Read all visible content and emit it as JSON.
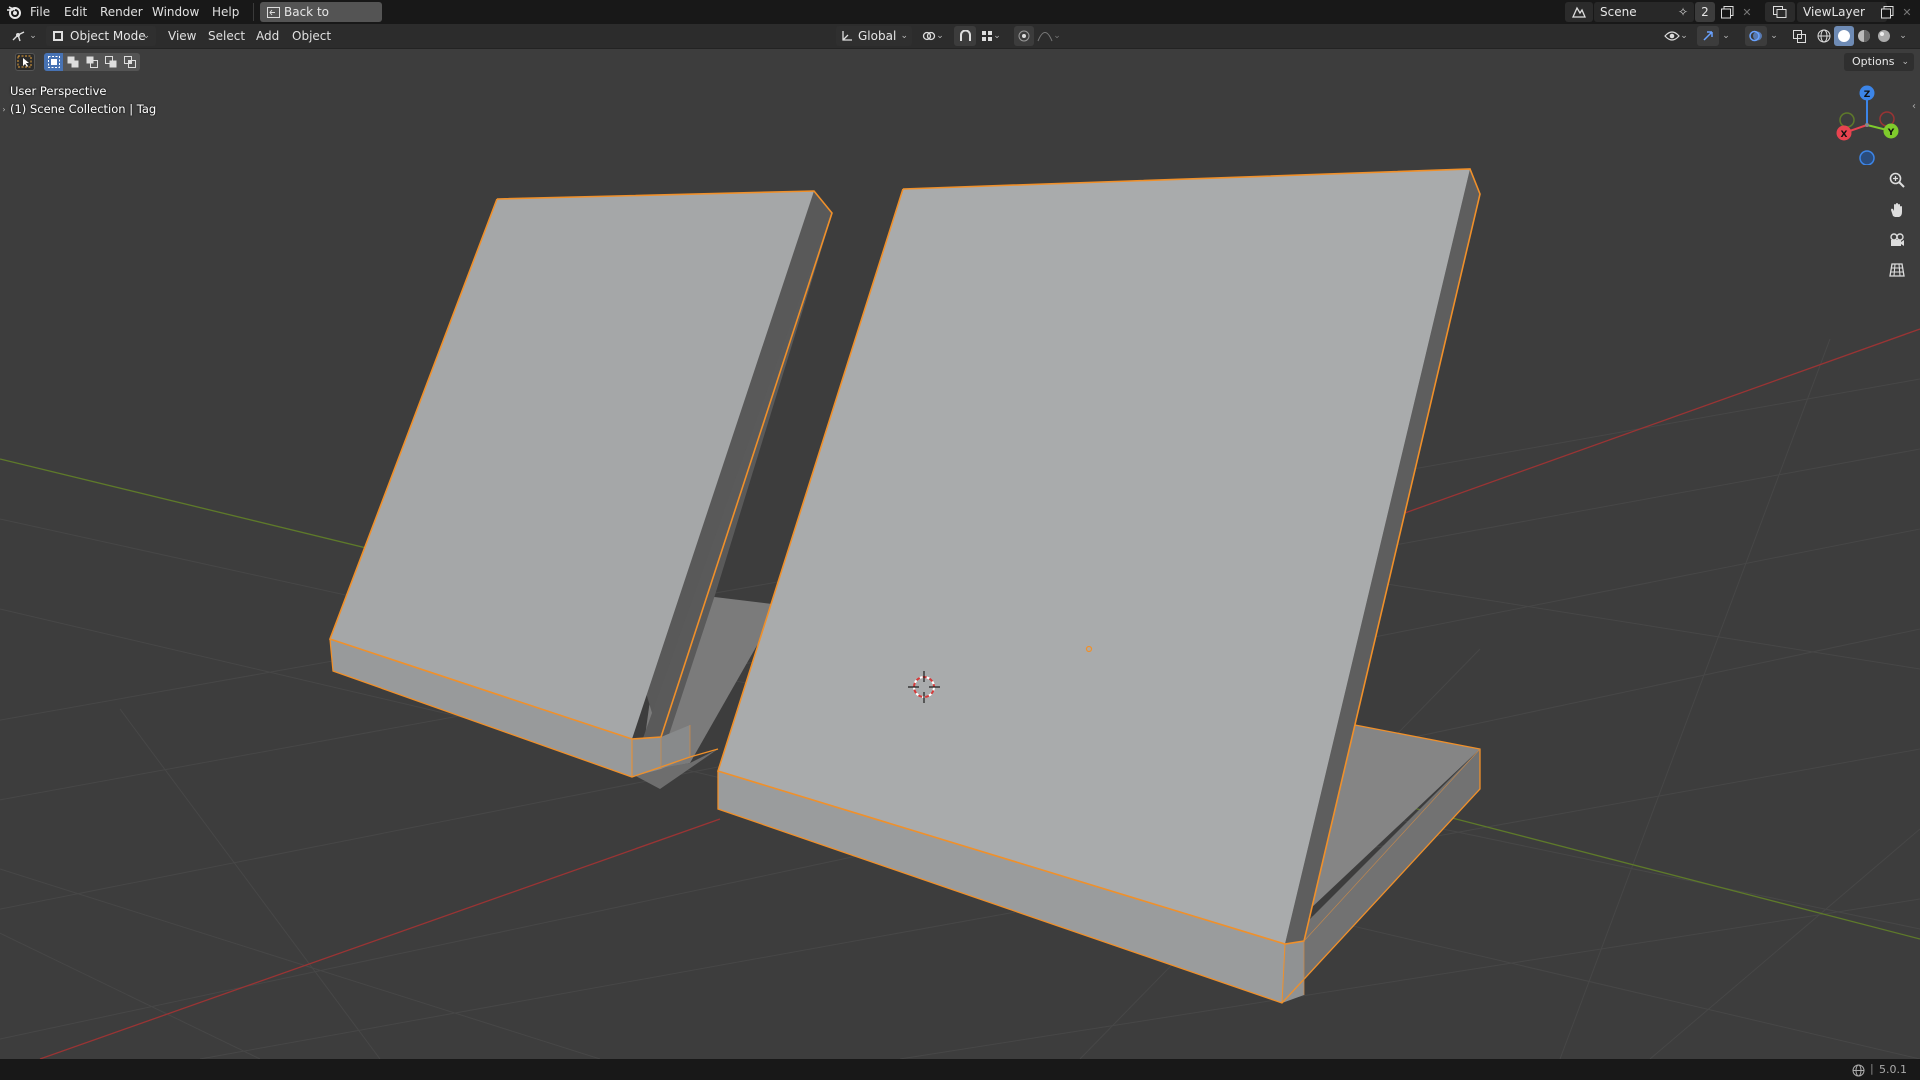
{
  "topbar": {
    "menus": [
      "File",
      "Edit",
      "Render",
      "Window",
      "Help"
    ],
    "back_button": "Back to Previous",
    "scene_name": "Scene",
    "scene_users": "2",
    "view_layer": "ViewLayer"
  },
  "header": {
    "mode": "Object Mode",
    "menus": [
      "View",
      "Select",
      "Add",
      "Object"
    ],
    "transform_orientation": "Global"
  },
  "viewport": {
    "options_label": "Options",
    "perspective_label": "User Perspective",
    "collection_label": "(1) Scene Collection | Tag",
    "gizmo_axes": {
      "x": "X",
      "y": "Y",
      "z": "Z"
    }
  },
  "statusbar": {
    "version": "5.0.1"
  },
  "colors": {
    "selection_outline": "#f0902a",
    "x_axis": "#b23a3a",
    "y_axis": "#6a8f2a",
    "gizmo_x": "#e8434f",
    "gizmo_y": "#7fcb2c",
    "gizmo_z": "#3c85e8"
  },
  "icons": [
    "blender-logo-icon",
    "back-icon",
    "scene-icon",
    "pin-icon",
    "new-scene-icon",
    "close-icon",
    "view-layer-icon",
    "editor-type-icon",
    "object-mode-icon",
    "transform-orientation-icon",
    "pivot-icon",
    "snap-icon",
    "proportional-icon",
    "visibility-icon",
    "gizmo-icon",
    "overlay-icon",
    "xray-icon",
    "shading-wireframe-icon",
    "shading-solid-icon",
    "shading-material-icon",
    "shading-rendered-icon",
    "select-box-icon",
    "zoom-icon",
    "hand-icon",
    "camera-icon",
    "grid-icon",
    "cursor-3d-icon",
    "language-icon"
  ]
}
